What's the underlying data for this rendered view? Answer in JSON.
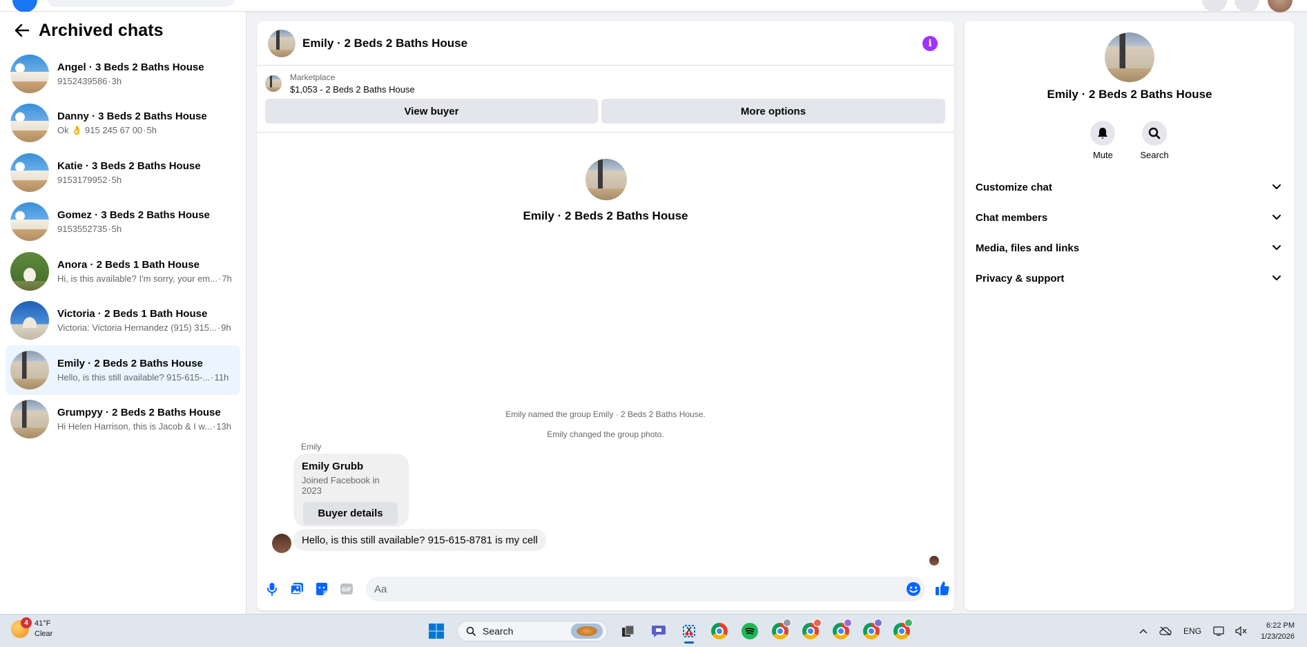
{
  "sidebar": {
    "title": "Archived chats",
    "chats": [
      {
        "name": "Angel · 3 Beds 2 Baths House",
        "preview": "9152439586",
        "time": "3h"
      },
      {
        "name": "Danny · 3 Beds 2 Baths House",
        "preview": "Ok 👌 915 245 67 00",
        "time": "5h"
      },
      {
        "name": "Katie · 3 Beds 2 Baths House",
        "preview": "9153179952",
        "time": "5h"
      },
      {
        "name": "Gomez · 3 Beds 2 Baths House",
        "preview": "9153552735",
        "time": "5h"
      },
      {
        "name": "Anora · 2 Beds 1 Bath House",
        "preview": "Hi, is this available? I'm sorry, your em...",
        "time": "7h"
      },
      {
        "name": "Victoria · 2 Beds 1 Bath House",
        "preview": "Victoria: Victoria Hernandez (915) 315...",
        "time": "9h"
      },
      {
        "name": "Emily · 2 Beds 2 Baths House",
        "preview": "Hello, is this still available? 915-615-...",
        "time": "11h"
      },
      {
        "name": "Grumpyy · 2 Beds 2 Baths House",
        "preview": "Hi Helen Harrison, this is Jacob & I w...",
        "time": "13h"
      }
    ]
  },
  "conversation": {
    "title": "Emily · 2 Beds 2 Baths House",
    "marketplace_label": "Marketplace",
    "listing": "$1,053 - 2 Beds 2 Baths House",
    "view_buyer": "View buyer",
    "more_options": "More options",
    "intro_title": "Emily · 2 Beds 2 Baths House",
    "system_messages": [
      "Emily named the group Emily · 2 Beds 2 Baths House.",
      "Emily changed the group photo."
    ],
    "sender": "Emily",
    "card": {
      "name": "Emily Grubb",
      "subtitle": "Joined Facebook in 2023",
      "button": "Buyer details"
    },
    "message": "Hello, is this still available? 915-615-8781 is my cell",
    "composer_placeholder": "Aa"
  },
  "details": {
    "title": "Emily · 2 Beds 2 Baths House",
    "actions": [
      {
        "label": "Mute",
        "icon": "bell-icon"
      },
      {
        "label": "Search",
        "icon": "search-icon"
      }
    ],
    "sections": [
      "Customize chat",
      "Chat members",
      "Media, files and links",
      "Privacy & support"
    ]
  },
  "taskbar": {
    "weather_temp": "41°F",
    "weather_desc": "Clear",
    "weather_badge": "4",
    "search_label": "Search",
    "language": "ENG",
    "time": "6:22 PM",
    "date": "1/23/2026"
  },
  "colors": {
    "accent": "#1877f2",
    "info": "#a033ff",
    "active_chat": "#ebf5ff"
  }
}
